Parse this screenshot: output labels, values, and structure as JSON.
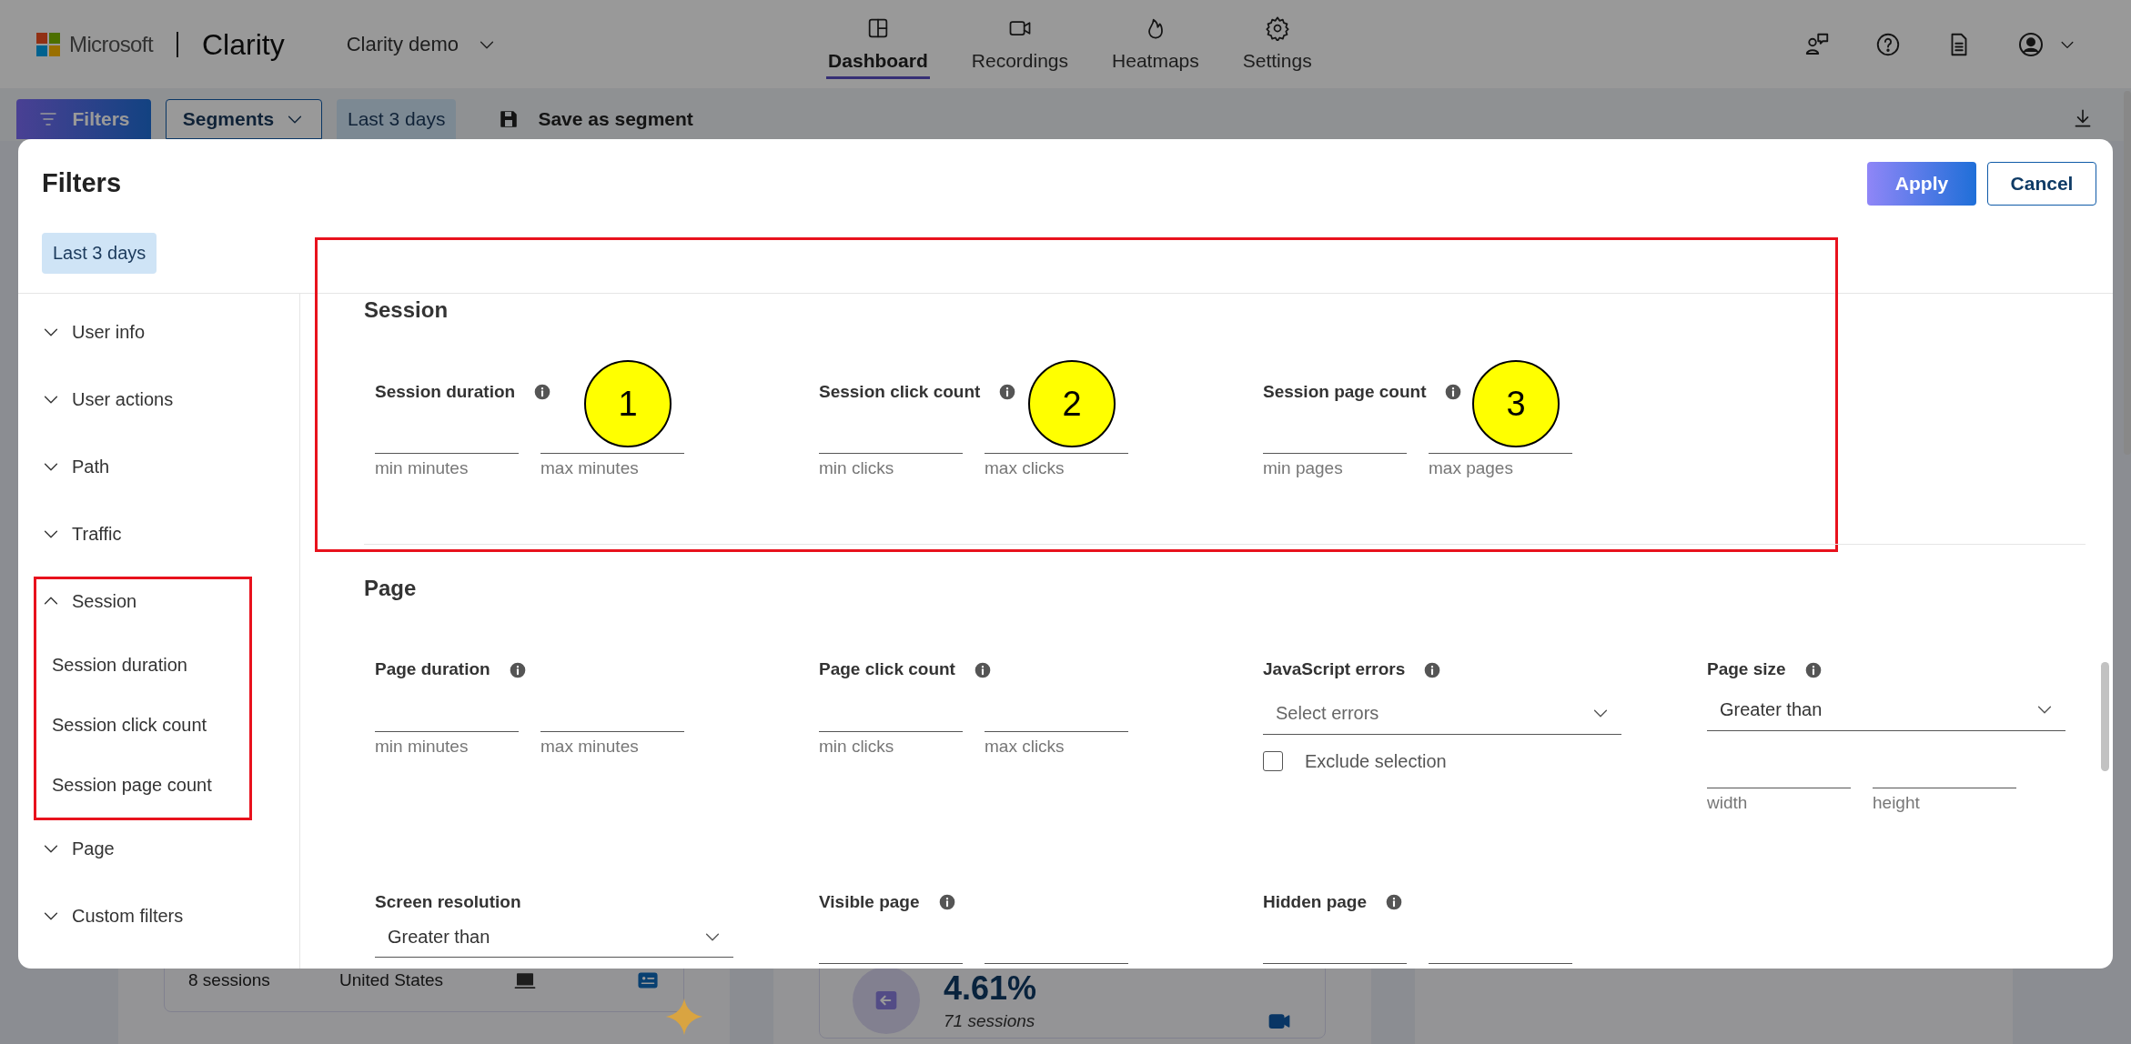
{
  "header": {
    "brand": "Microsoft",
    "product": "Clarity",
    "project": "Clarity demo",
    "nav": [
      {
        "label": "Dashboard",
        "selected": true
      },
      {
        "label": "Recordings",
        "selected": false
      },
      {
        "label": "Heatmaps",
        "selected": false
      },
      {
        "label": "Settings",
        "selected": false
      }
    ]
  },
  "toolbar": {
    "filters": "Filters",
    "segments": "Segments",
    "date_range": "Last 3 days",
    "save_segment": "Save as segment"
  },
  "dashboard": {
    "cards": [
      {
        "kind": "country",
        "sessions": "8 sessions",
        "country": "United States"
      },
      {
        "kind": "metric",
        "value": "4.61%",
        "sessions": "71 sessions"
      },
      {
        "kind": "empty"
      }
    ]
  },
  "modal": {
    "title": "Filters",
    "apply": "Apply",
    "cancel": "Cancel",
    "date_chip": "Last 3 days",
    "sidebar": [
      {
        "label": "User info",
        "expanded": false,
        "highlighted": false
      },
      {
        "label": "User actions",
        "expanded": false,
        "highlighted": false
      },
      {
        "label": "Path",
        "expanded": false,
        "highlighted": false
      },
      {
        "label": "Traffic",
        "expanded": false,
        "highlighted": false
      },
      {
        "label": "Session",
        "expanded": true,
        "highlighted": true,
        "children": [
          {
            "label": "Session duration"
          },
          {
            "label": "Session click count"
          },
          {
            "label": "Session page count"
          }
        ]
      },
      {
        "label": "Page",
        "expanded": false,
        "highlighted": false
      },
      {
        "label": "Custom filters",
        "expanded": false,
        "highlighted": false
      }
    ],
    "sections": [
      {
        "title": "Session",
        "highlighted": true,
        "fields": [
          {
            "kind": "range",
            "label": "Session duration",
            "info": true,
            "marker": "1",
            "captions": [
              "min minutes",
              "max minutes"
            ]
          },
          {
            "kind": "range",
            "label": "Session click count",
            "info": true,
            "marker": "2",
            "captions": [
              "min clicks",
              "max clicks"
            ]
          },
          {
            "kind": "range",
            "label": "Session page count",
            "info": true,
            "marker": "3",
            "captions": [
              "min pages",
              "max pages"
            ]
          }
        ]
      },
      {
        "title": "Page",
        "highlighted": false,
        "fields": [
          {
            "kind": "range",
            "label": "Page duration",
            "info": true,
            "captions": [
              "min minutes",
              "max minutes"
            ]
          },
          {
            "kind": "range",
            "label": "Page click count",
            "info": true,
            "captions": [
              "min clicks",
              "max clicks"
            ]
          },
          {
            "kind": "select_checkbox",
            "label": "JavaScript errors",
            "info": true,
            "placeholder": "Select errors",
            "checkbox": {
              "label": "Exclude selection",
              "checked": false
            }
          },
          {
            "kind": "select_range",
            "label": "Page size",
            "info": true,
            "value": "Greater than",
            "captions": [
              "width",
              "height"
            ]
          },
          {
            "kind": "select",
            "label": "Screen resolution",
            "info": false,
            "value": "Greater than"
          },
          {
            "kind": "range",
            "label": "Visible page",
            "info": true
          },
          {
            "kind": "range",
            "label": "Hidden page",
            "info": true
          }
        ]
      }
    ]
  }
}
